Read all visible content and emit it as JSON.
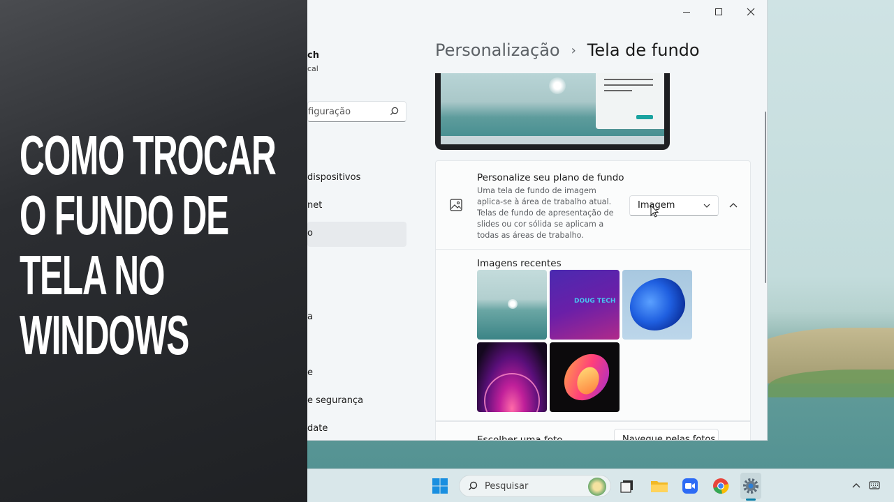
{
  "overlay": {
    "title_lines": [
      "COMO TROCAR",
      "O FUNDO DE",
      "TELA NO",
      "WINDOWS"
    ]
  },
  "window": {
    "controls": [
      "minimize-icon",
      "maximize-icon",
      "close-icon"
    ],
    "sidebar": {
      "profile_name": "ch",
      "profile_sub": "cal",
      "search_text": "figuração",
      "items": [
        {
          "label": "dispositivos"
        },
        {
          "label": "net"
        },
        {
          "label": "o",
          "active": true
        },
        {
          "label": "a"
        },
        {
          "label": "e"
        },
        {
          "label": "e segurança"
        },
        {
          "label": "date"
        }
      ]
    },
    "breadcrumb": {
      "parent": "Personalização",
      "separator": "›",
      "current": "Tela de fundo"
    },
    "background_card": {
      "icon": "image-icon",
      "title": "Personalize seu plano de fundo",
      "description": "Uma tela de fundo de imagem aplica-se à área de trabalho atual. Telas de fundo de apresentação de slides ou cor sólida se aplicam a todas as áreas de trabalho.",
      "dropdown_value": "Imagem"
    },
    "recent": {
      "title": "Imagens recentes",
      "images": [
        {
          "name": "lake-landscape"
        },
        {
          "name": "doug-tech-logo",
          "text": "DOUG TECH"
        },
        {
          "name": "windows-bloom-blue"
        },
        {
          "name": "purple-glow"
        },
        {
          "name": "colorful-abstract"
        }
      ]
    },
    "choose_photo": {
      "label": "Escolher uma foto",
      "button": "Navegue pelas fotos"
    }
  },
  "taskbar": {
    "search_placeholder": "Pesquisar",
    "apps": [
      "windows-start-icon",
      "search-box",
      "task-view-icon",
      "file-explorer-icon",
      "zoom-icon",
      "chrome-icon",
      "settings-icon"
    ],
    "tray": [
      "chevron-up-icon",
      "keyboard-icon"
    ]
  },
  "colors": {
    "accent": "#1aa3a0",
    "taskbar_indicator": "#0a7fa8",
    "window_bg": "#f3f6f8"
  }
}
